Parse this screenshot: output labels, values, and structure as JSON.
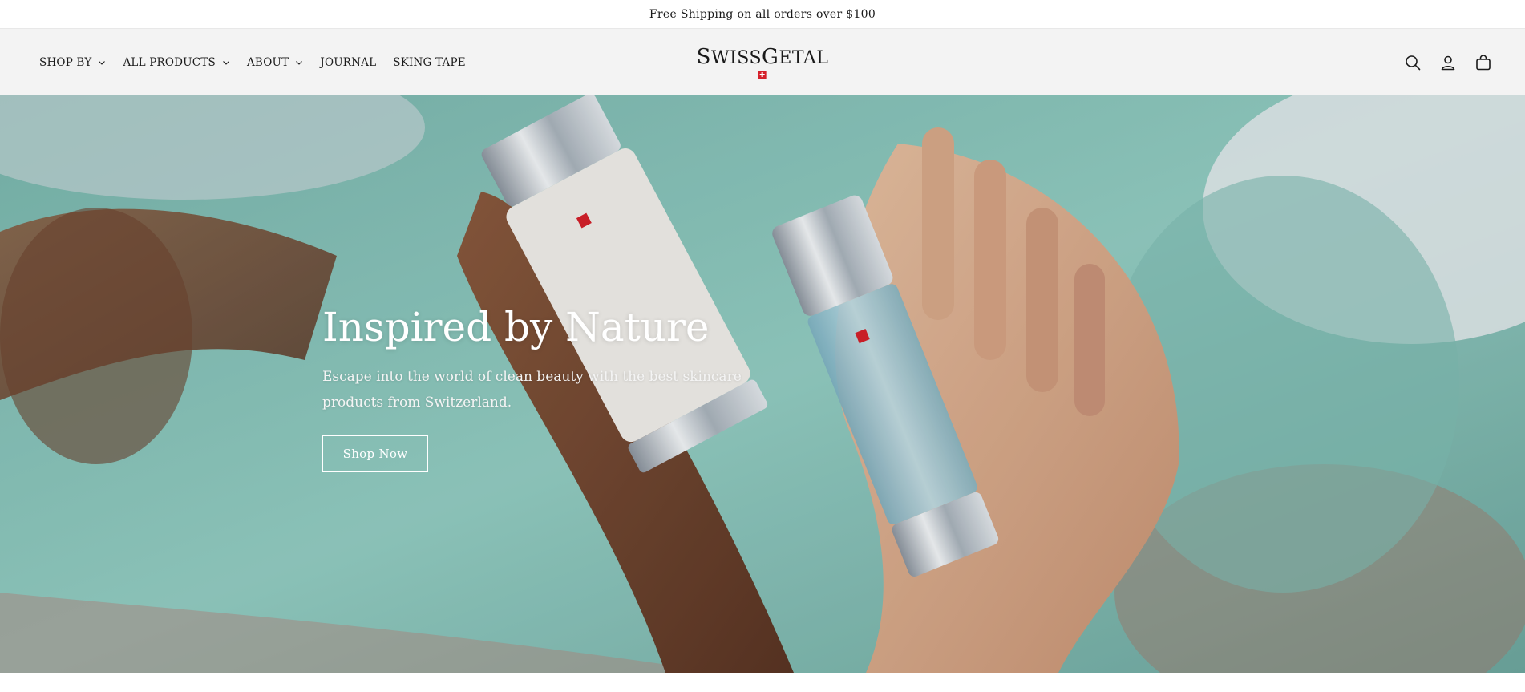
{
  "announcement": {
    "text": "Free Shipping on all orders over $100"
  },
  "header": {
    "nav": [
      {
        "label": "SHOP BY",
        "has_dropdown": true
      },
      {
        "label": "ALL PRODUCTS",
        "has_dropdown": true
      },
      {
        "label": "ABOUT",
        "has_dropdown": true
      },
      {
        "label": "JOURNAL",
        "has_dropdown": false
      },
      {
        "label": "SKING TAPE",
        "has_dropdown": false
      }
    ],
    "logo": {
      "first": "S",
      "rest1": "WISS",
      "second": "G",
      "rest2": "ETAL"
    },
    "icons": [
      "search-icon",
      "account-icon",
      "cart-icon"
    ]
  },
  "hero": {
    "title": "Inspired by Nature",
    "subtitle": "Escape into the world of clean beauty with the best skincare products from Switzerland.",
    "button_label": "Shop Now"
  },
  "colors": {
    "header_bg": "#f3f3f3",
    "hero_teal": "#8fc7bf",
    "swiss_red": "#d5202a"
  }
}
